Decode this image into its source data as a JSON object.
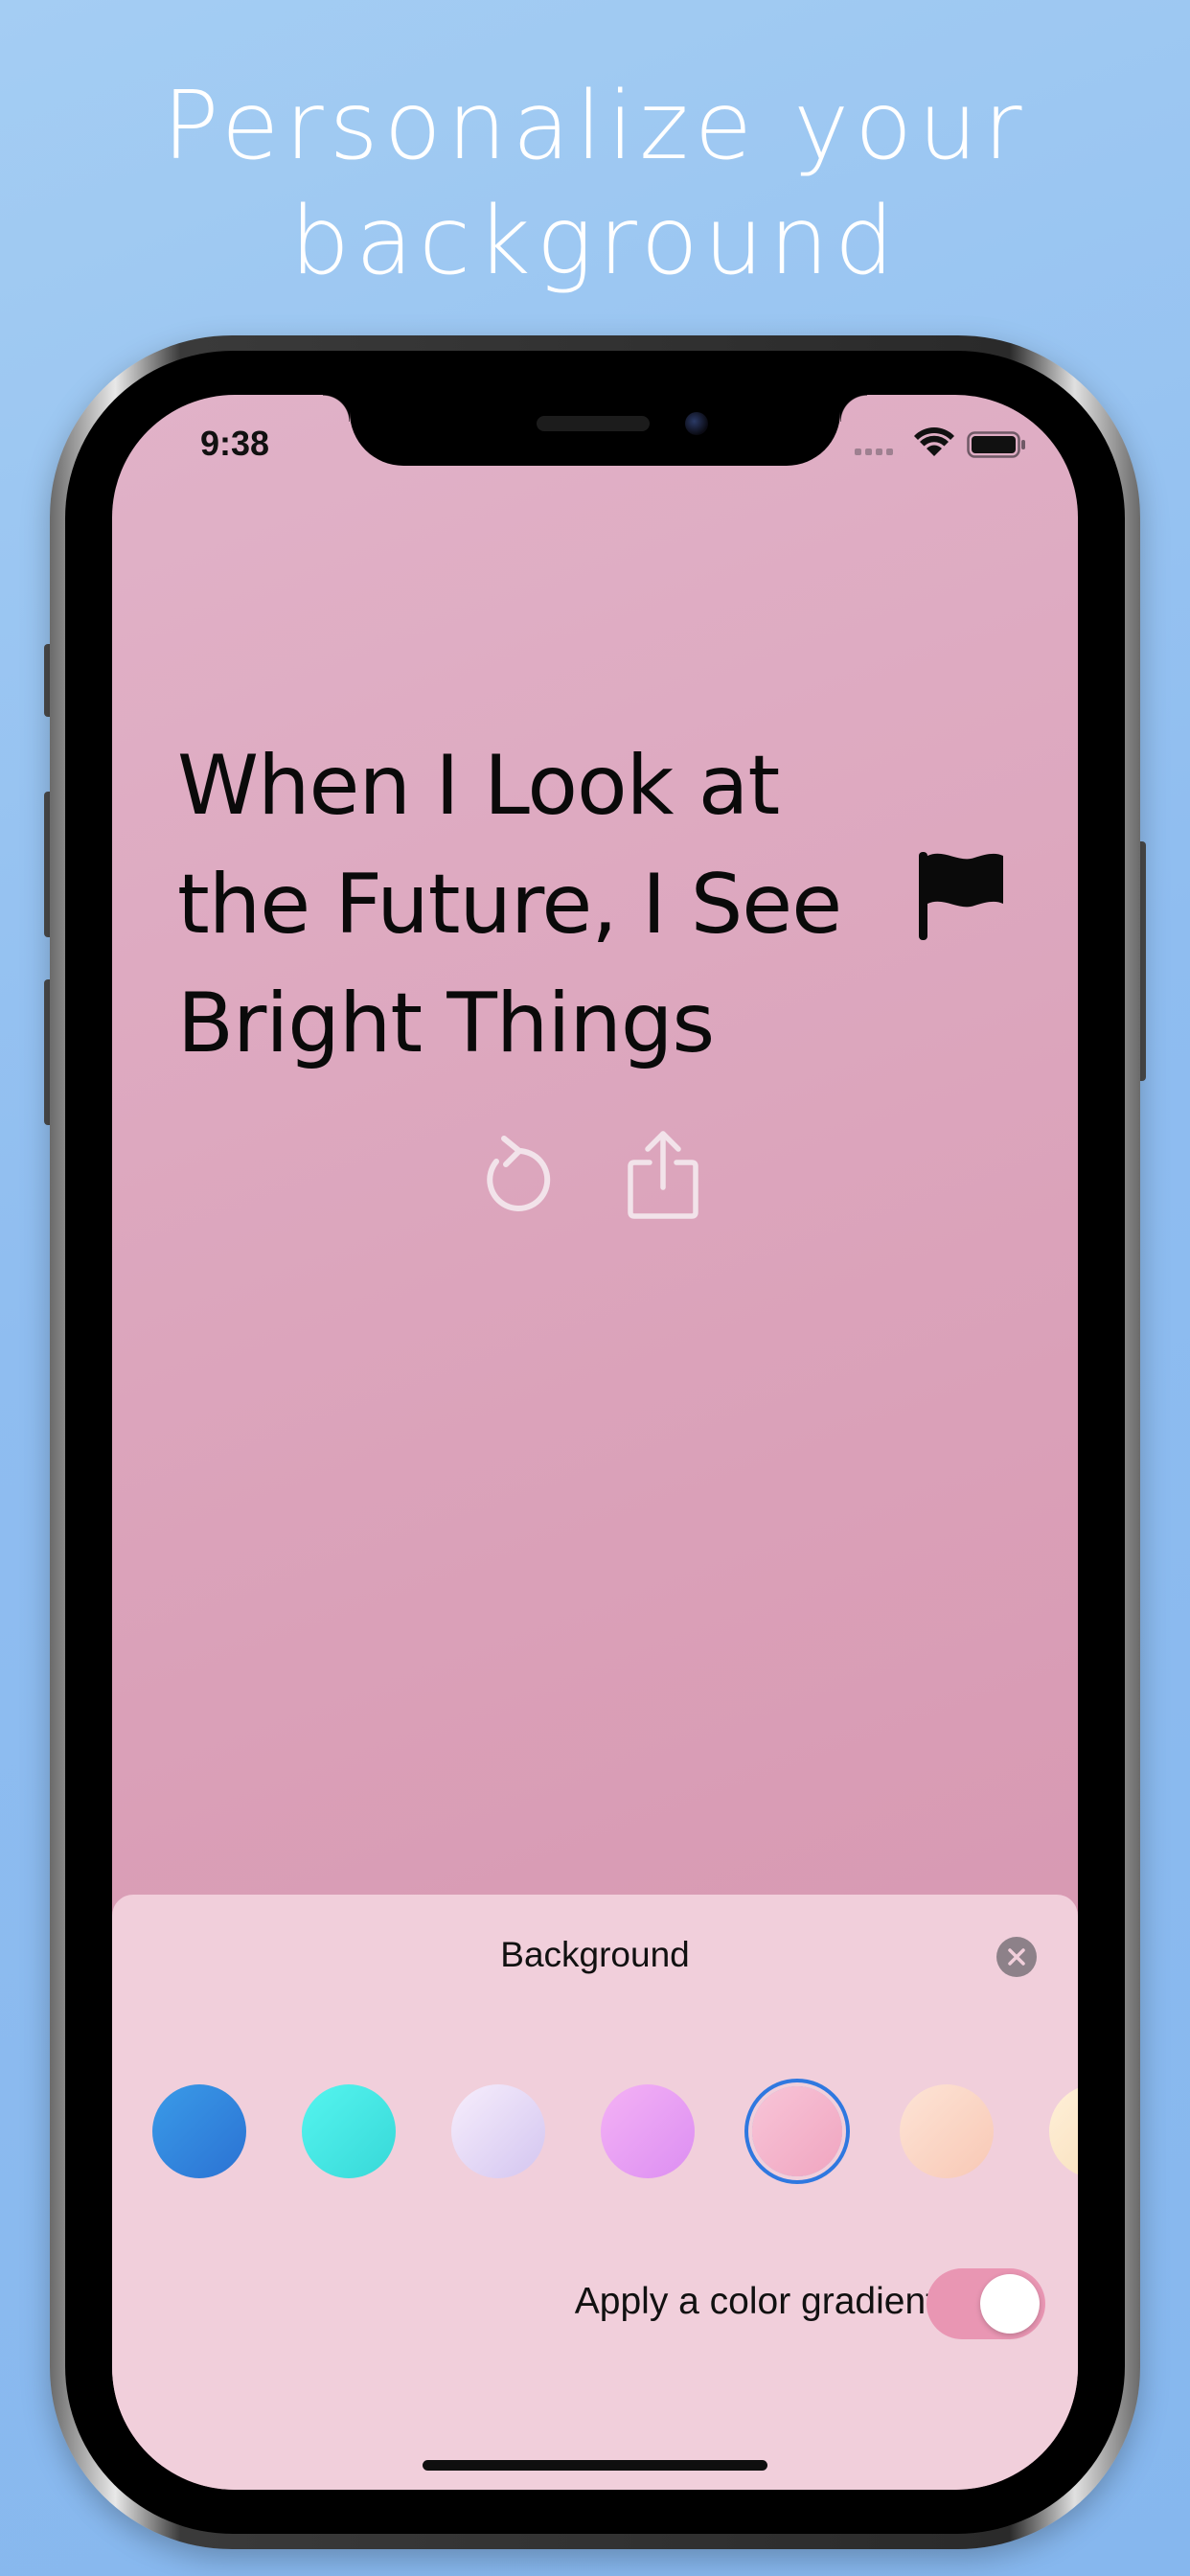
{
  "headline": {
    "line1": "Personalize your",
    "line2": "background"
  },
  "status_bar": {
    "time": "9:38",
    "icons": [
      "signal-icon",
      "wifi-icon",
      "battery-icon"
    ]
  },
  "quote": {
    "text": "When I Look at the Future, I See Bright Things",
    "icon": "flag-icon"
  },
  "actions": {
    "icons": [
      "refresh-icon",
      "share-icon"
    ]
  },
  "sheet": {
    "title": "Background",
    "close_icon": "close-icon",
    "swatches": [
      {
        "name": "blue",
        "from": "#3a9be8",
        "to": "#2b72d3",
        "selected": false
      },
      {
        "name": "cyan",
        "from": "#55f5ef",
        "to": "#37d8d8",
        "selected": false
      },
      {
        "name": "lavender",
        "from": "#f7eefc",
        "to": "#d3c5f0",
        "selected": false
      },
      {
        "name": "violet",
        "from": "#f4b2f5",
        "to": "#dc8ef2",
        "selected": false
      },
      {
        "name": "pink",
        "from": "#f8c5d8",
        "to": "#f0a5c0",
        "selected": true
      },
      {
        "name": "peach",
        "from": "#fde4d6",
        "to": "#f8c8b5",
        "selected": false
      },
      {
        "name": "cream",
        "from": "#fff0d8",
        "to": "#f6dcb8",
        "selected": false
      }
    ],
    "gradient_toggle": {
      "label": "Apply a color gradient",
      "on": true
    }
  },
  "colors": {
    "background_blue": "#8fbdf0",
    "screen_pink": "#daa0b8",
    "sheet_pink": "#f1cfdb",
    "selection_blue": "#2f78e0",
    "toggle_pink": "#e996b3"
  }
}
